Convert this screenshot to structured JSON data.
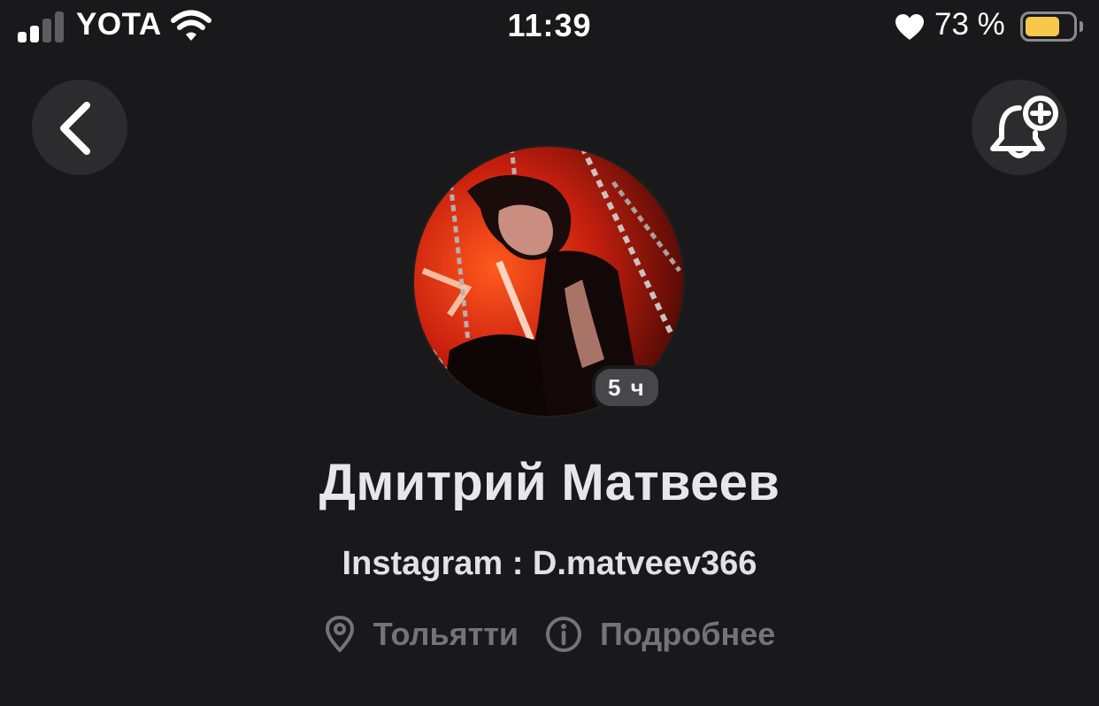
{
  "status_bar": {
    "carrier": "YOTA",
    "time": "11:39",
    "battery_percent_label": "73 %",
    "battery_level": 0.73,
    "signal_bars_active": 2,
    "signal_bars_total": 4,
    "icons": [
      "cellular-signal-icon",
      "wifi-icon",
      "heart-icon",
      "battery-icon"
    ],
    "battery_color": "#f6c94c"
  },
  "nav": {
    "back_icon": "chevron-left-icon",
    "subscribe_icon": "bell-plus-icon"
  },
  "profile": {
    "story_badge": "5 ч",
    "name": "Дмитрий Матвеев",
    "status": "Instagram : D.matveev366",
    "city": "Тольятти",
    "details_label": "Подробнее",
    "city_icon": "location-pin-icon",
    "details_icon": "info-icon"
  },
  "colors": {
    "background": "#19191b",
    "button_bg": "#2c2c2f",
    "text_primary": "#e7e7eb",
    "text_muted": "#737378"
  }
}
